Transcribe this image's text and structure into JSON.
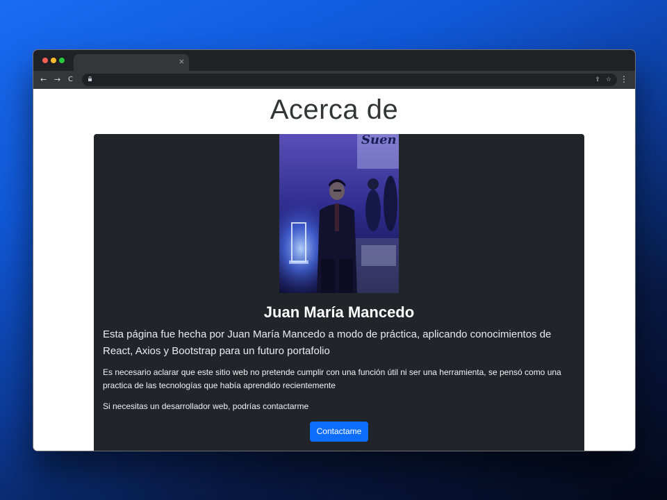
{
  "browser": {
    "tab_close_glyph": "×",
    "nav": {
      "back": "←",
      "forward": "→",
      "reload": "C"
    },
    "address_icons": {
      "share": "⇪",
      "star": "☆"
    },
    "menu_glyph": "⋮"
  },
  "page": {
    "title": "Acerca de",
    "card": {
      "name": "Juan María Mancedo",
      "lead": "Esta página fue hecha por Juan María Mancedo a modo de práctica, aplicando conocimientos de React, Axios y Bootstrap para un futuro portafolio",
      "paragraph_1": "Es necesario aclarar que este sitio web no pretende cumplir con una función útil ni ser una herramienta, se pensó como una practica de las tecnologías que había aprendido recientemente",
      "paragraph_2": "Si necesitas un desarrollador web, podrías contactarme",
      "button_label": "Contactame"
    }
  },
  "colors": {
    "card_bg": "#212529",
    "button_bg": "#0d6efd",
    "background_gradient_start": "#1a6cf2",
    "background_gradient_end": "#05081a"
  }
}
